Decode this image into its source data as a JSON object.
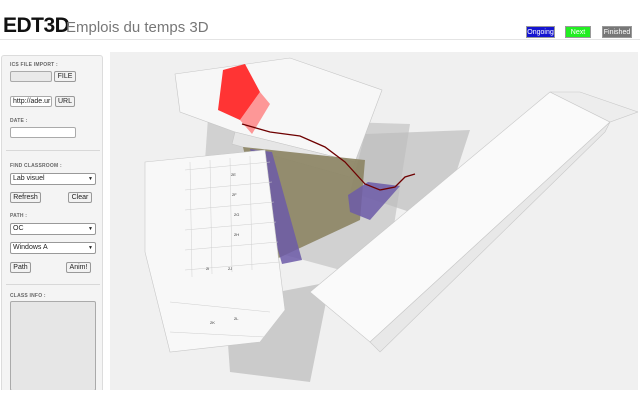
{
  "header": {
    "brand": "EDT3D",
    "subtitle": "Emplois du temps 3D"
  },
  "legend": [
    {
      "label": "Ongoing",
      "color": "#1414d0"
    },
    {
      "label": "Next",
      "color": "#22ee22"
    },
    {
      "label": "Finished",
      "color": "#777777"
    }
  ],
  "sidebar": {
    "ics_label": "ICS FILE IMPORT :",
    "file_button": "FILE",
    "url_value": "http://ade.ur",
    "url_button": "URL",
    "date_label": "DATE :",
    "date_value": "",
    "find_label": "FIND CLASSROOM :",
    "classroom_selected": "Lab visuel",
    "refresh_button": "Refresh",
    "clear_button": "Clear",
    "path_label": "PATH :",
    "path_from_selected": "OC",
    "path_to_selected": "Windows A",
    "path_button": "Path",
    "anim_button": "Anim!",
    "class_info_label": "CLASS INFO :"
  },
  "viewport": {
    "room_labels": [
      "2E",
      "2F",
      "2G",
      "2H",
      "2I",
      "2J",
      "2K",
      "2L"
    ],
    "highlight_colors": {
      "target": "#ff2a2a",
      "route": "#7a0000",
      "zone": "#6c5aa8",
      "ground": "#8d8565"
    }
  }
}
